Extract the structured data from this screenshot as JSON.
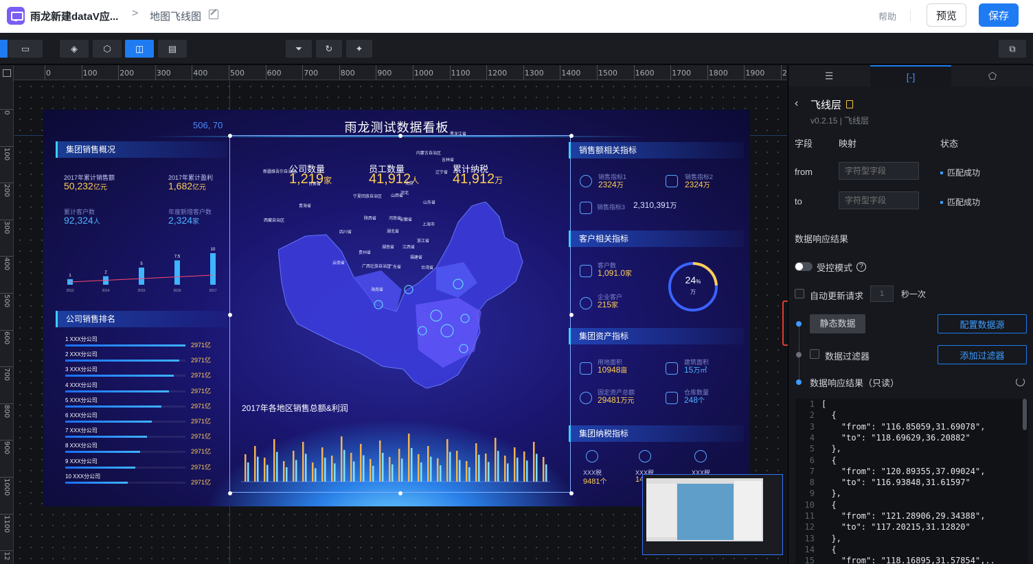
{
  "header": {
    "app_name": "雨龙新建dataV应...",
    "crumb_sep": ">",
    "page_name": "地图飞线图",
    "help": "帮助",
    "preview": "预览",
    "save": "保存"
  },
  "ruler": {
    "x_labels": [
      "0",
      "100",
      "200",
      "300",
      "400",
      "500",
      "600",
      "700",
      "800",
      "900",
      "1000",
      "1100",
      "1200",
      "1300",
      "1400",
      "1500",
      "1600",
      "1700",
      "1800",
      "1900",
      "2"
    ],
    "y_labels": [
      "0",
      "100",
      "200",
      "300",
      "400",
      "500",
      "600",
      "700",
      "800",
      "900",
      "1000",
      "1100",
      "12"
    ]
  },
  "canvas": {
    "coord": "506, 70"
  },
  "dashboard": {
    "title": "雨龙测试数据看板",
    "left": {
      "sec1": "集团销售概况",
      "kpis": [
        {
          "label": "2017年累计销售额",
          "value": "50,232",
          "unit": "亿元"
        },
        {
          "label": "2017年累计盈利",
          "value": "1,682",
          "unit": "亿元"
        },
        {
          "label": "累计客户数",
          "value": "92,324",
          "unit": "人"
        },
        {
          "label": "年度新增客户数",
          "value": "2,324",
          "unit": "家"
        }
      ],
      "mini_chart": {
        "years": [
          "2013",
          "2014",
          "2015",
          "2016",
          "2017"
        ],
        "values": [
          "1",
          "2",
          "5",
          "7.5",
          "10"
        ]
      },
      "sec2": "公司销售排名",
      "ranks": [
        {
          "name": "1   XXX分公司",
          "value": "2971亿",
          "ratio": 1.0
        },
        {
          "name": "2   XXX分公司",
          "value": "2971亿",
          "ratio": 0.95
        },
        {
          "name": "3   XXX分公司",
          "value": "2971亿",
          "ratio": 0.9
        },
        {
          "name": "4   XXX分公司",
          "value": "2971亿",
          "ratio": 0.86
        },
        {
          "name": "5   XXX分公司",
          "value": "2971亿",
          "ratio": 0.8
        },
        {
          "name": "6   XXX分公司",
          "value": "2971亿",
          "ratio": 0.72
        },
        {
          "name": "7   XXX分公司",
          "value": "2971亿",
          "ratio": 0.68
        },
        {
          "name": "8   XXX分公司",
          "value": "2971亿",
          "ratio": 0.62
        },
        {
          "name": "9   XXX分公司",
          "value": "2971亿",
          "ratio": 0.58
        },
        {
          "name": "10   XXX分公司",
          "value": "2971亿",
          "ratio": 0.52
        }
      ]
    },
    "center": {
      "kpis": [
        {
          "label": "公司数量",
          "value": "1,219",
          "unit": "家"
        },
        {
          "label": "员工数量",
          "value": "41,912",
          "unit": "人"
        },
        {
          "label": "累计纳税",
          "value": "41,912",
          "unit": "万"
        }
      ],
      "provinces": [
        "黑龙江省",
        "吉林省",
        "辽宁省",
        "内蒙古自治区",
        "北京",
        "河北",
        "山西省",
        "山东省",
        "新疆维吾尔自治区",
        "甘肃省",
        "青海省",
        "宁夏回族自治区",
        "陕西省",
        "河南省",
        "西藏自治区",
        "四川省",
        "湖北省",
        "安徽省",
        "上海市",
        "浙江省",
        "贵州省",
        "湖南省",
        "江西省",
        "福建省",
        "云南省",
        "广西壮族自治区",
        "广东省",
        "台湾省",
        "海南省"
      ],
      "bar_title": "2017年各地区销售总额&利润"
    },
    "right": {
      "sec1": "销售额相关指标",
      "sales": [
        {
          "label": "销售指标1",
          "value": "2324",
          "unit": "万"
        },
        {
          "label": "销售指标2",
          "value": "2324",
          "unit": "万"
        },
        {
          "label": "销售指标3",
          "value": "2,310,391",
          "unit": "万"
        }
      ],
      "sec2": "客户相关指标",
      "customers": [
        {
          "label": "客户数",
          "value": "1,091.0",
          "unit": "家"
        },
        {
          "label": "企业客户",
          "value": "215",
          "unit": "家"
        }
      ],
      "donut": {
        "value": "24",
        "unit": "%",
        "sub": "万",
        "ratio": 0.24
      },
      "sec3": "集团资产指标",
      "assets": [
        {
          "label": "用地面积",
          "value": "10948",
          "unit": "亩"
        },
        {
          "label": "建筑面积",
          "value": "15",
          "unit": "万㎡"
        },
        {
          "label": "固定资产总额",
          "value": "29481",
          "unit": "万元"
        },
        {
          "label": "仓库数量",
          "value": "248",
          "unit": "个"
        }
      ],
      "sec4": "集团纳税指标",
      "taxes": [
        {
          "label": "XXX税",
          "value": "9481",
          "unit": "个"
        },
        {
          "label": "XXX税",
          "value": "14",
          "unit": ""
        },
        {
          "label": "XXX税",
          "value": "",
          "unit": ""
        }
      ]
    }
  },
  "panel": {
    "title": "飞线层",
    "version": "v0.2.15 | 飞线层",
    "col_field": "字段",
    "col_map": "映射",
    "col_status": "状态",
    "fields": [
      {
        "name": "from",
        "placeholder": "字符型字段",
        "status": "匹配成功"
      },
      {
        "name": "to",
        "placeholder": "字符型字段",
        "status": "匹配成功"
      }
    ],
    "section": "数据响应结果",
    "controlled": "受控模式",
    "auto_update": "自动更新请求",
    "interval_value": "1",
    "interval_unit": "秒一次",
    "static_data": "静态数据",
    "config_source": "配置数据源",
    "data_filter": "数据过滤器",
    "add_filter": "添加过滤器",
    "response_readonly": "数据响应结果（只读）",
    "code_lines": [
      "[",
      "  {",
      "    \"from\": \"116.85059,31.69078\",",
      "    \"to\": \"118.69629,36.20882\"",
      "  },",
      "  {",
      "    \"from\": \"120.89355,37.09024\",",
      "    \"to\": \"116.93848,31.61597\"",
      "  },",
      "  {",
      "    \"from\": \"121.28906,29.34388\",",
      "    \"to\": \"117.20215,31.12820\"",
      "  },",
      "  {",
      "    \"from\": \"118.16895,31.57854\",.."
    ]
  },
  "colors": {
    "accent": "#1f7bf2",
    "highlight_box": "#e23b2e",
    "value_yellow": "#ffce55",
    "value_blue": "#4fb3ff"
  }
}
